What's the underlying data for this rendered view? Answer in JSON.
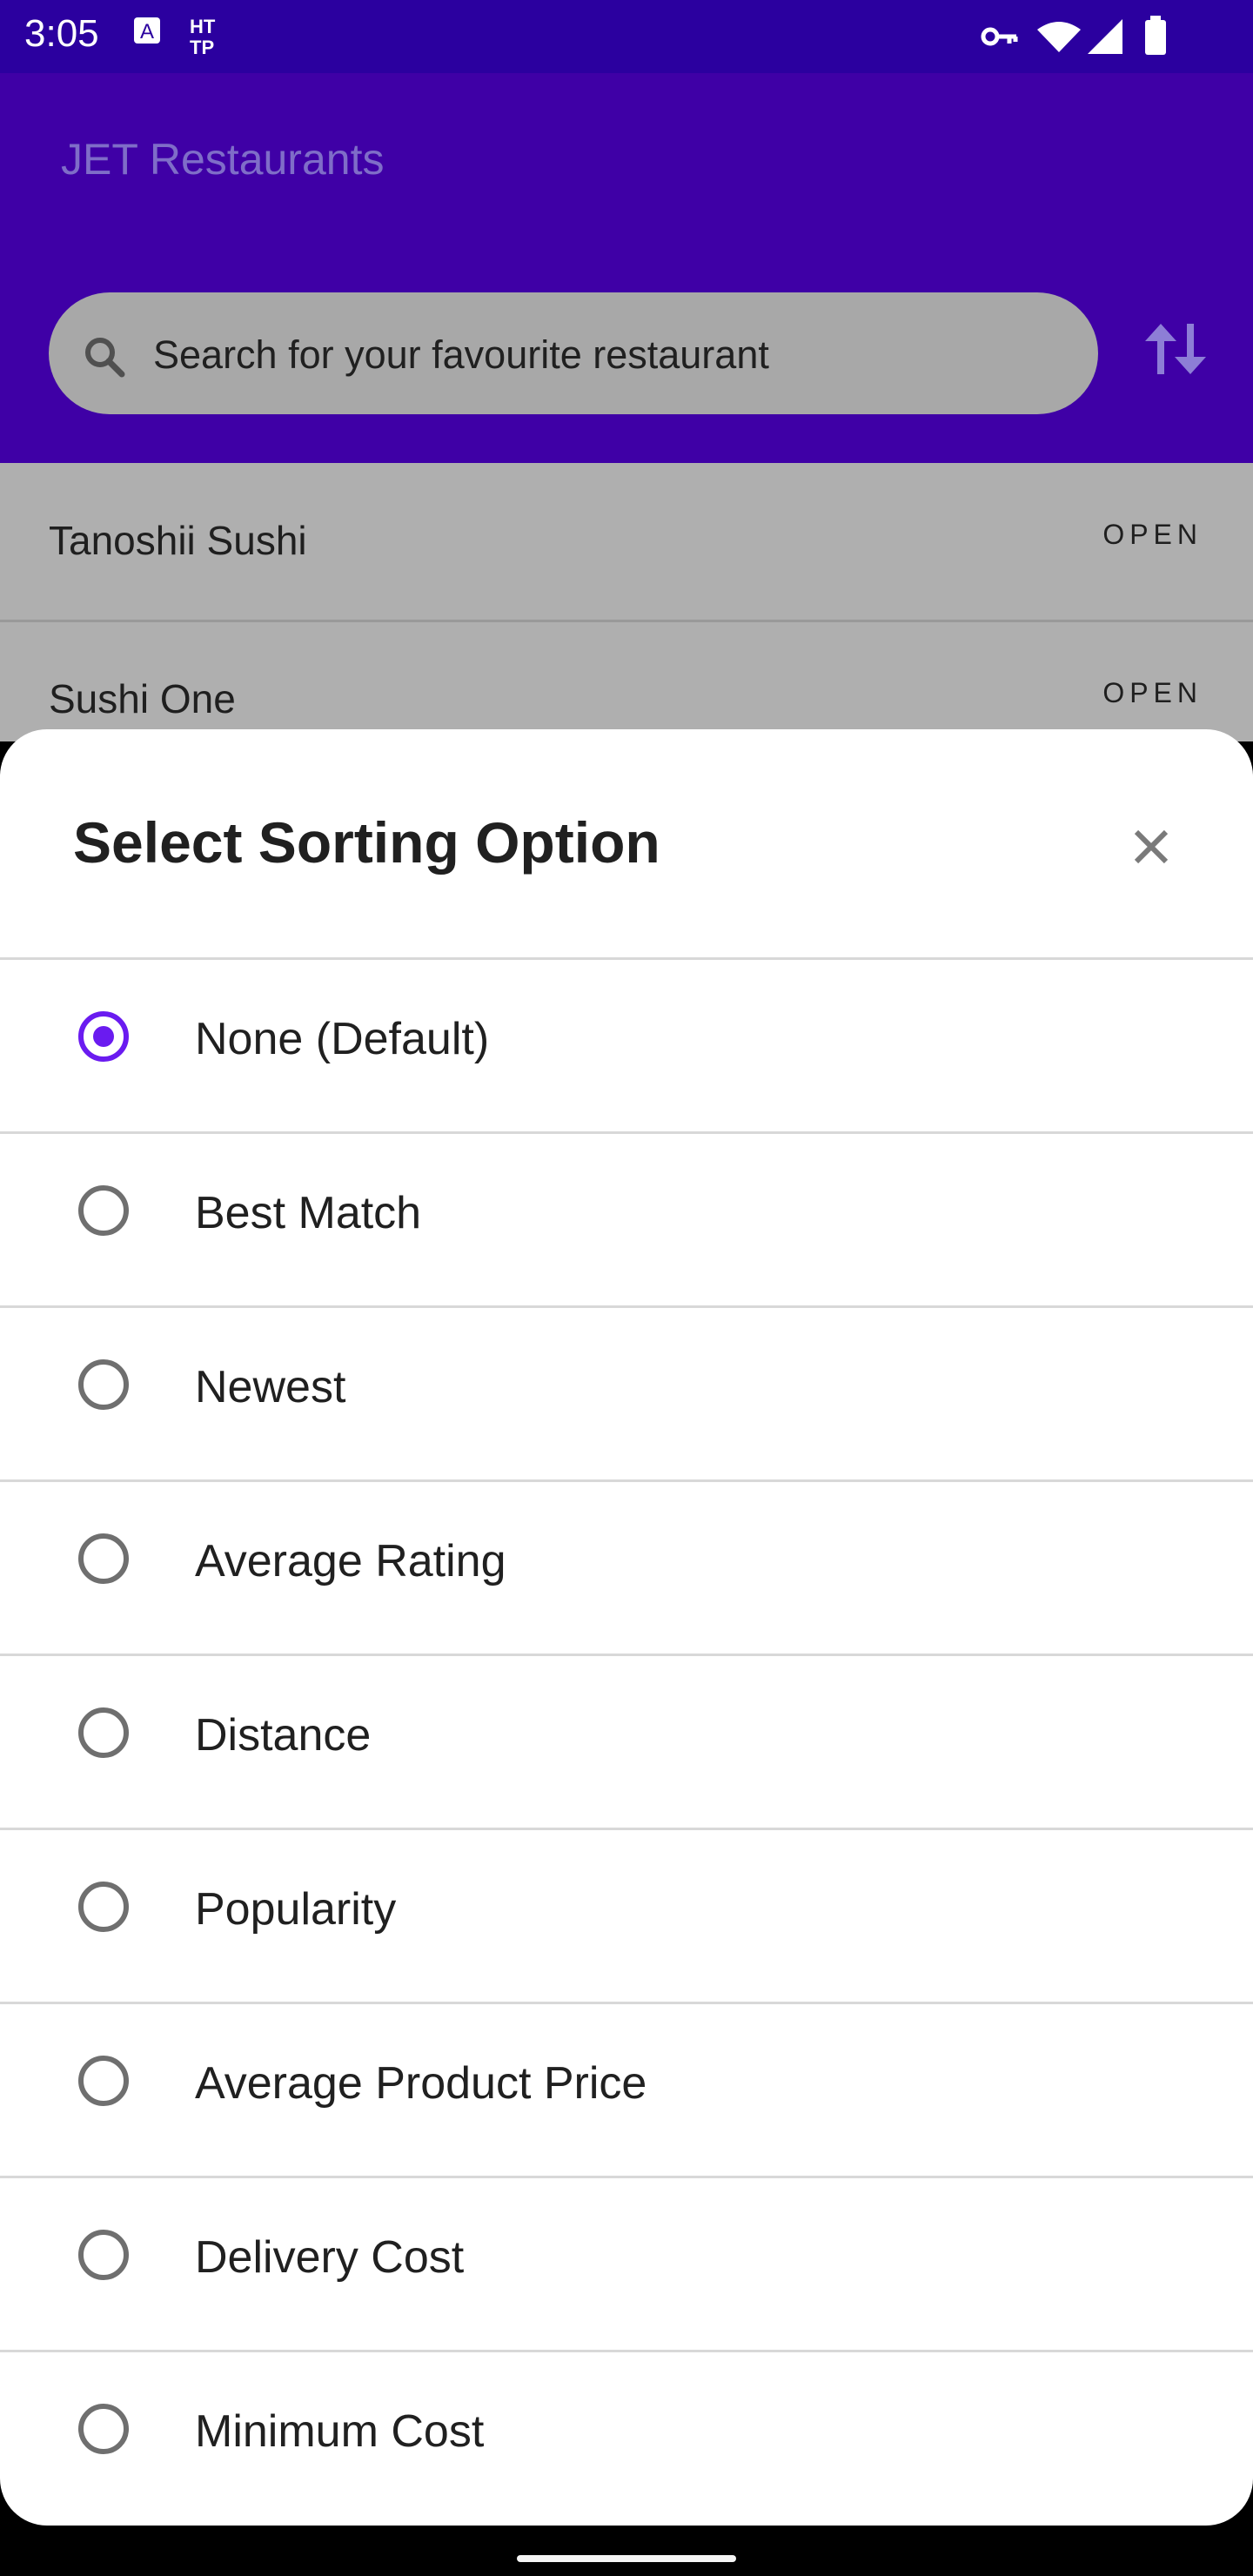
{
  "status_bar": {
    "time": "3:05"
  },
  "app": {
    "title": "JET Restaurants"
  },
  "search": {
    "placeholder": "Search for your favourite restaurant"
  },
  "list": [
    {
      "name": "Tanoshii Sushi",
      "status": "OPEN"
    },
    {
      "name": "Sushi One",
      "status": "OPEN"
    }
  ],
  "sheet": {
    "title": "Select Sorting Option",
    "options": [
      {
        "label": "None (Default)",
        "selected": true
      },
      {
        "label": "Best Match",
        "selected": false
      },
      {
        "label": "Newest",
        "selected": false
      },
      {
        "label": "Average Rating",
        "selected": false
      },
      {
        "label": "Distance",
        "selected": false
      },
      {
        "label": "Popularity",
        "selected": false
      },
      {
        "label": "Average Product Price",
        "selected": false
      },
      {
        "label": "Delivery Cost",
        "selected": false
      },
      {
        "label": "Minimum Cost",
        "selected": false
      }
    ]
  },
  "colors": {
    "status_bar": "#2b009f",
    "app_bar": "#3f00a6",
    "accent": "#6a1bf0"
  }
}
